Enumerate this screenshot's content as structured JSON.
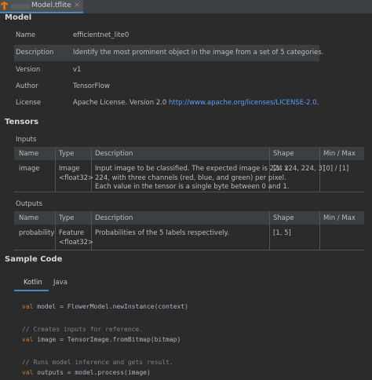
{
  "tab": {
    "filename": "Model.tflite",
    "close": "×"
  },
  "model": {
    "heading": "Model",
    "rows": [
      {
        "key": "Name",
        "value": "efficientnet_lite0"
      },
      {
        "key": "Description",
        "value": "Identify the most prominent object in the image from a set of 5 categories."
      },
      {
        "key": "Version",
        "value": "v1"
      },
      {
        "key": "Author",
        "value": "TensorFlow"
      },
      {
        "key": "License",
        "value": "Apache License. Version 2.0",
        "link": "http://www.apache.org/licenses/LICENSE-2.0",
        "suffix": "."
      }
    ]
  },
  "tensors": {
    "heading": "Tensors",
    "columns": [
      "Name",
      "Type",
      "Description",
      "Shape",
      "Min / Max"
    ],
    "inputs": {
      "label": "Inputs",
      "row": {
        "name": "image",
        "type1": "Image",
        "type2": "<float32>",
        "desc": [
          "Input image to be classified. The expected image is 224 x",
          "224, with three channels (red, blue, and green) per pixel.",
          "Each value in the tensor is a single byte between 0 and 1."
        ],
        "shape": "[1, 224, 224, 3]",
        "minmax": "[0] / [1]"
      }
    },
    "outputs": {
      "label": "Outputs",
      "row": {
        "name": "probability",
        "type1": "Feature",
        "type2": "<float32>",
        "desc": "Probabilities of the 5 labels respectively.",
        "shape": "[1, 5]",
        "minmax": ""
      }
    }
  },
  "sample": {
    "heading": "Sample Code",
    "tabs": [
      "Kotlin",
      "Java"
    ],
    "lines": [
      {
        "kw": "val",
        "text": " model = FlowerModel.newInstance(context)"
      },
      {
        "comment": "// Creates inputs for reference."
      },
      {
        "kw": "val",
        "text": " image = TensorImage.fromBitmap(bitmap)"
      },
      {
        "comment": "// Runs model inference and gets result."
      },
      {
        "kw": "val",
        "text": " outputs = model.process(image)"
      }
    ]
  }
}
